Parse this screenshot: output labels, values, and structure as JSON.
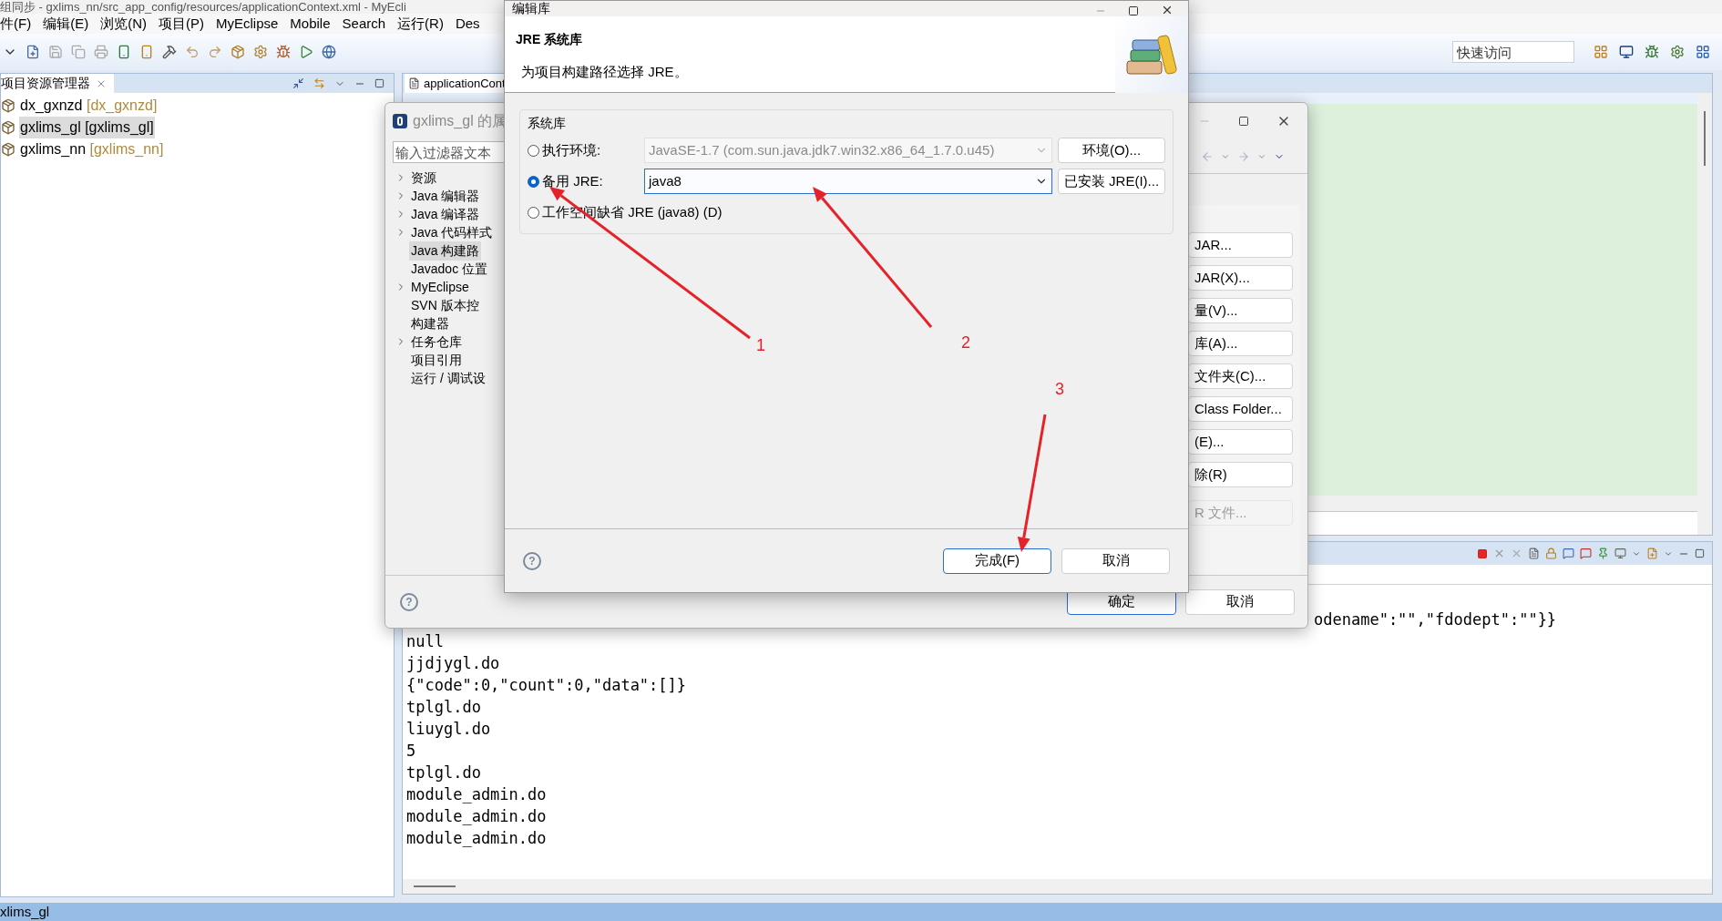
{
  "ide": {
    "title": "组同步 - gxlims_nn/src_app_config/resources/applicationContext.xml - MyEcli",
    "menu": [
      "件(F)",
      "编辑(E)",
      "浏览(N)",
      "项目(P)",
      "MyEclipse",
      "Mobile",
      "Search",
      "运行(R)",
      "Des"
    ],
    "quick_access": {
      "placeholder": "快速访问"
    },
    "explorer": {
      "tab": "项目资源管理器",
      "projects": [
        {
          "name": "dx_gxnzd",
          "label": "[dx_gxnzd]",
          "color": "#b08a3e",
          "selected": false
        },
        {
          "name": "gxlims_gl",
          "label": "[gxlims_gl]",
          "color": "#000000",
          "selected": true
        },
        {
          "name": "gxlims_nn",
          "label": "[gxlims_nn]",
          "color": "#b08a3e",
          "selected": false
        }
      ]
    },
    "editor_tab": "applicationCont",
    "console": {
      "lines": [
        {
          "kind": "covered",
          "text": "odename\":\"\",\"fdodept\":\"\"}}"
        },
        {
          "kind": "full",
          "text": "null"
        },
        {
          "kind": "full",
          "text": "jjdjygl.do"
        },
        {
          "kind": "full",
          "text": "{\"code\":0,\"count\":0,\"data\":[]}"
        },
        {
          "kind": "full",
          "text": "tplgl.do"
        },
        {
          "kind": "full",
          "text": "liuygl.do"
        },
        {
          "kind": "full",
          "text": "5"
        },
        {
          "kind": "full",
          "text": "tplgl.do"
        },
        {
          "kind": "full",
          "text": "module_admin.do"
        },
        {
          "kind": "full",
          "text": "module_admin.do"
        },
        {
          "kind": "full",
          "text": "module_admin.do"
        }
      ]
    },
    "status": "xlims_gl"
  },
  "properties_dialog": {
    "title": "gxlims_gl 的属",
    "filter": {
      "placeholder": "输入过滤器文本"
    },
    "tree": [
      {
        "label": "资源",
        "expandable": true,
        "selected": false
      },
      {
        "label": "Java 编辑器",
        "expandable": true,
        "selected": false
      },
      {
        "label": "Java 编译器",
        "expandable": true,
        "selected": false
      },
      {
        "label": "Java 代码样式",
        "expandable": true,
        "selected": false
      },
      {
        "label": "Java 构建路",
        "expandable": false,
        "selected": true
      },
      {
        "label": "Javadoc 位置",
        "expandable": false,
        "selected": false
      },
      {
        "label": "MyEclipse",
        "expandable": true,
        "selected": false
      },
      {
        "label": "SVN 版本控",
        "expandable": false,
        "selected": false
      },
      {
        "label": "构建器",
        "expandable": false,
        "selected": false
      },
      {
        "label": "任务仓库",
        "expandable": true,
        "selected": false
      },
      {
        "label": "项目引用",
        "expandable": false,
        "selected": false
      },
      {
        "label": "运行 / 调试设",
        "expandable": false,
        "selected": false
      }
    ],
    "side_buttons": [
      {
        "label": "JAR...",
        "disabled": false
      },
      {
        "label": "JAR(X)...",
        "disabled": false
      },
      {
        "label": "量(V)...",
        "disabled": false
      },
      {
        "label": "库(A)...",
        "disabled": false
      },
      {
        "label": "文件夹(C)...",
        "disabled": false
      },
      {
        "label": "Class Folder...",
        "disabled": false
      },
      {
        "label": "(E)...",
        "disabled": false
      },
      {
        "label": "除(R)",
        "disabled": false
      },
      {
        "label": "R 文件...",
        "disabled": true
      }
    ],
    "help": "?",
    "ok": "确定",
    "cancel": "取消"
  },
  "jre_dialog": {
    "title": "编辑库",
    "heading": "JRE 系统库",
    "description": "为项目构建路径选择 JRE。",
    "group": "系统库",
    "options": [
      {
        "kind": "combo",
        "label": "执行环境:",
        "value": "JavaSE-1.7  (com.sun.java.jdk7.win32.x86_64_1.7.0.u45)",
        "disabled": true,
        "button": "环境(O)...",
        "selected": false
      },
      {
        "kind": "combo",
        "label": "备用 JRE:",
        "value": "java8",
        "disabled": false,
        "button": "已安装 JRE(I)...",
        "selected": true
      },
      {
        "kind": "plain",
        "label": "工作空间缺省 JRE  (java8)  (D)",
        "selected": false
      }
    ],
    "help": "?",
    "finish": "完成(F)",
    "cancel": "取消"
  },
  "annotations": [
    {
      "label": "1"
    },
    {
      "label": "2"
    },
    {
      "label": "3"
    }
  ]
}
